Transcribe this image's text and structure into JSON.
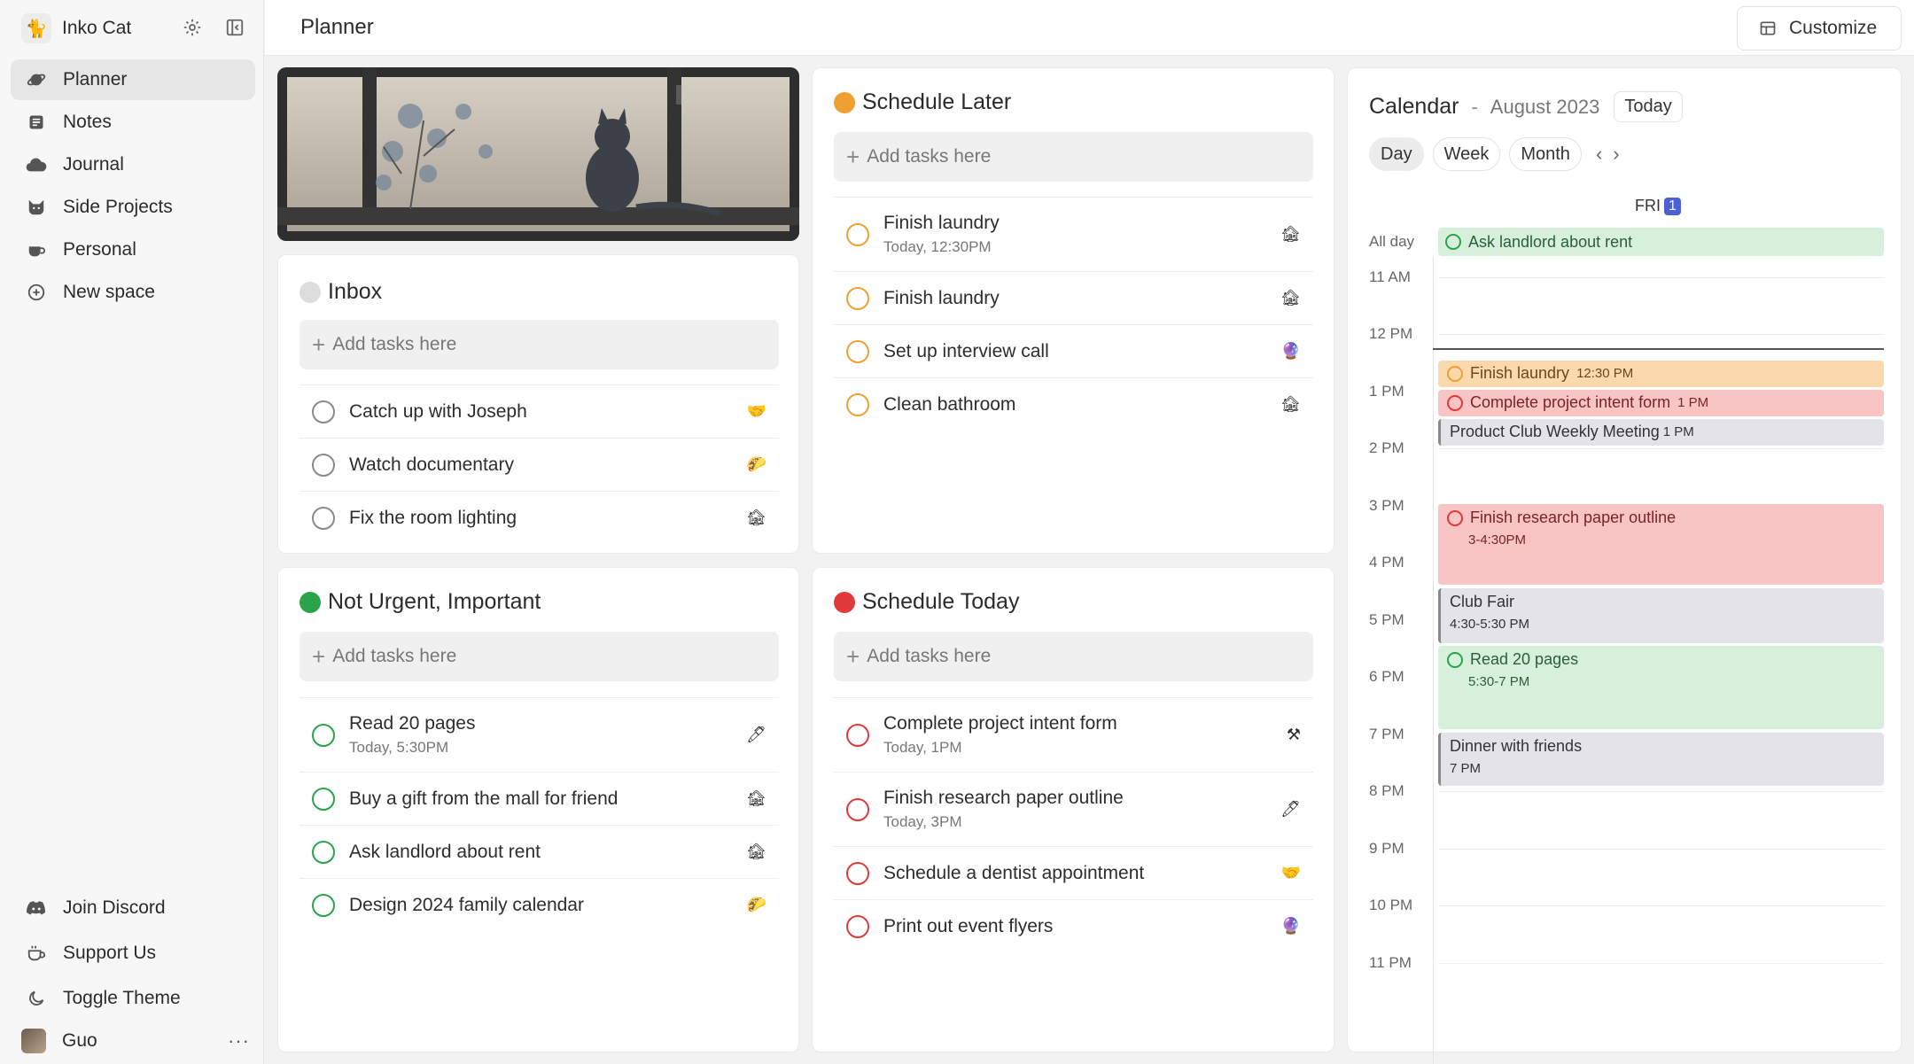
{
  "sidebar": {
    "workspace_name": "Inko Cat",
    "items": [
      {
        "label": "Planner",
        "icon": "planet-icon"
      },
      {
        "label": "Notes",
        "icon": "note-icon"
      },
      {
        "label": "Journal",
        "icon": "cloud-icon"
      },
      {
        "label": "Side Projects",
        "icon": "cat-icon"
      },
      {
        "label": "Personal",
        "icon": "coffee-icon"
      },
      {
        "label": "New space",
        "icon": "plus-circle-icon"
      }
    ],
    "bottom_items": [
      {
        "label": "Join Discord",
        "icon": "discord-icon"
      },
      {
        "label": "Support Us",
        "icon": "cup-icon"
      },
      {
        "label": "Toggle Theme",
        "icon": "moon-icon"
      }
    ],
    "user_name": "Guo",
    "user_more": "···"
  },
  "header": {
    "title": "Planner",
    "customize_label": "Customize"
  },
  "common": {
    "add_placeholder": "Add tasks here"
  },
  "inbox": {
    "title": "Inbox",
    "tasks": [
      {
        "title": "Catch up with Joseph",
        "emoji": "🤝"
      },
      {
        "title": "Watch documentary",
        "emoji": "🌮"
      },
      {
        "title": "Fix the room lighting",
        "emoji": "🏚"
      }
    ]
  },
  "schedule_later": {
    "title": "Schedule Later",
    "tasks": [
      {
        "title": "Finish laundry",
        "sub": "Today, 12:30PM",
        "emoji": "🏚"
      },
      {
        "title": "Finish laundry",
        "emoji": "🏚"
      },
      {
        "title": "Set up interview call",
        "emoji": "🔮"
      },
      {
        "title": "Clean bathroom",
        "emoji": "🏚"
      }
    ]
  },
  "not_urgent": {
    "title": "Not Urgent, Important",
    "tasks": [
      {
        "title": "Read 20 pages",
        "sub": "Today, 5:30PM",
        "emoji": "🖊"
      },
      {
        "title": "Buy a gift from the mall for friend",
        "emoji": "🏚"
      },
      {
        "title": "Ask landlord about rent",
        "emoji": "🏚"
      },
      {
        "title": "Design 2024 family calendar",
        "emoji": "🌮"
      }
    ]
  },
  "schedule_today": {
    "title": "Schedule Today",
    "tasks": [
      {
        "title": "Complete project intent form",
        "sub": "Today, 1PM",
        "emoji": "⚒"
      },
      {
        "title": "Finish research paper outline",
        "sub": "Today, 3PM",
        "emoji": "🖊"
      },
      {
        "title": "Schedule a dentist appointment",
        "emoji": "🤝"
      },
      {
        "title": "Print out event flyers",
        "emoji": "🔮"
      }
    ]
  },
  "calendar": {
    "title": "Calendar",
    "sep": "-",
    "month": "August 2023",
    "today_label": "Today",
    "views": [
      "Day",
      "Week",
      "Month"
    ],
    "prev": "‹",
    "next": "›",
    "day_label": "FRI",
    "day_num": "1",
    "allday_label": "All day",
    "allday_event": "Ask landlord about rent",
    "hours": [
      "11 AM",
      "12 PM",
      "1 PM",
      "2 PM",
      "3 PM",
      "4 PM",
      "5 PM",
      "6 PM",
      "7 PM",
      "8 PM",
      "9 PM",
      "10 PM",
      "11 PM"
    ],
    "events": [
      {
        "title": "Finish laundry",
        "time": "12:30 PM"
      },
      {
        "title": "Complete project intent form",
        "time": "1 PM"
      },
      {
        "title": "Product Club Weekly Meeting",
        "time": "1 PM"
      },
      {
        "title": "Finish research paper outline",
        "time": "3-4:30PM"
      },
      {
        "title": "Club Fair",
        "time": "4:30-5:30 PM"
      },
      {
        "title": "Read 20 pages",
        "time": "5:30-7 PM"
      },
      {
        "title": "Dinner with friends",
        "time": "7 PM"
      }
    ]
  },
  "colors": {
    "orange": "#f0a030",
    "green": "#2aa44a",
    "red": "#e03a3a",
    "accent": "#4c5fd5"
  }
}
